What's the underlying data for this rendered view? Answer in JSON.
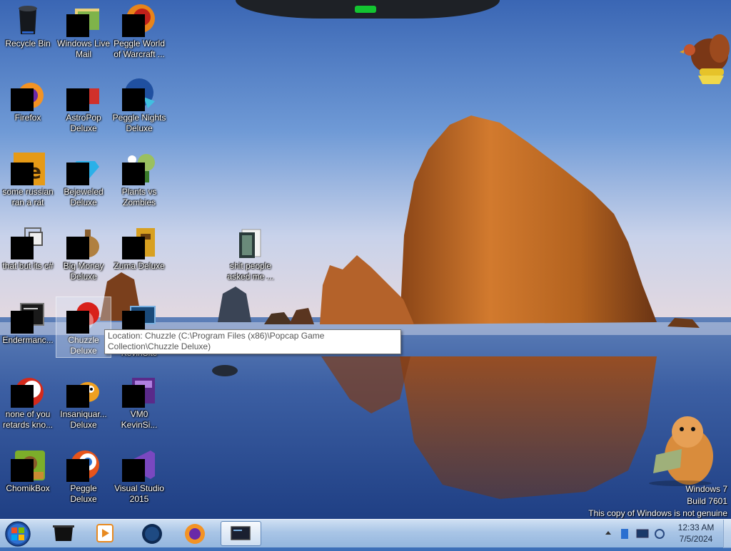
{
  "desktop_icons": [
    {
      "label": "Recycle Bin",
      "icon": "recycle-bin-icon"
    },
    {
      "label": "Windows Live Mail",
      "icon": "windows-live-mail-icon"
    },
    {
      "label": "Peggle World of Warcraft ...",
      "icon": "peggle-wow-icon"
    },
    {
      "label": "Firefox",
      "icon": "firefox-icon"
    },
    {
      "label": "AstroPop Deluxe",
      "icon": "astropop-icon"
    },
    {
      "label": "Peggle Nights Deluxe",
      "icon": "peggle-nights-icon"
    },
    {
      "label": "some russian ran a rat",
      "icon": "ae-file-icon"
    },
    {
      "label": "Bejeweled Deluxe",
      "icon": "bejeweled-icon"
    },
    {
      "label": "Plants vs Zombies",
      "icon": "plants-vs-zombies-icon"
    },
    {
      "label": "that but its c#",
      "icon": "shortcut-icon"
    },
    {
      "label": "Big Money Deluxe",
      "icon": "big-money-icon"
    },
    {
      "label": "Zuma Deluxe",
      "icon": "zuma-icon"
    },
    {
      "label": "shit people asked me ...",
      "icon": "folder-icon"
    },
    {
      "label": "Endermanc...",
      "icon": "console-icon"
    },
    {
      "label": "Chuzzle Deluxe",
      "icon": "chuzzle-icon"
    },
    {
      "label": "KevinSite",
      "icon": "kevinsite-icon"
    },
    {
      "label": "none of you retards kno...",
      "icon": "peggle-ball-icon"
    },
    {
      "label": "Insaniquar... Deluxe",
      "icon": "insaniquarium-icon"
    },
    {
      "label": "VM0 KevinSi...",
      "icon": "vm-icon"
    },
    {
      "label": "ChomikBox",
      "icon": "chomikbox-icon"
    },
    {
      "label": "Peggle Deluxe",
      "icon": "peggle-icon"
    },
    {
      "label": "Visual Studio 2015",
      "icon": "visual-studio-icon"
    }
  ],
  "tooltip": {
    "text": "Location: Chuzzle (C:\\Program Files (x86)\\Popcap Game Collection\\Chuzzle Deluxe)"
  },
  "watermark": {
    "line1": "Windows 7",
    "line2": "Build 7601",
    "line3": "This copy of Windows is not genuine"
  },
  "taskbar": {
    "pinned": [
      {
        "icon": "black-app-icon"
      },
      {
        "icon": "media-player-icon"
      },
      {
        "icon": "globe-icon"
      },
      {
        "icon": "firefox-icon"
      },
      {
        "icon": "terminal-window-icon"
      }
    ]
  },
  "tray": {
    "time": "12:33 AM",
    "date": "7/5/2024"
  },
  "colors": {
    "sky_top": "#3a66b4",
    "sky_bottom": "#d8dcef",
    "taskbar": "#a9c5e6",
    "rock": "#c2722c"
  }
}
